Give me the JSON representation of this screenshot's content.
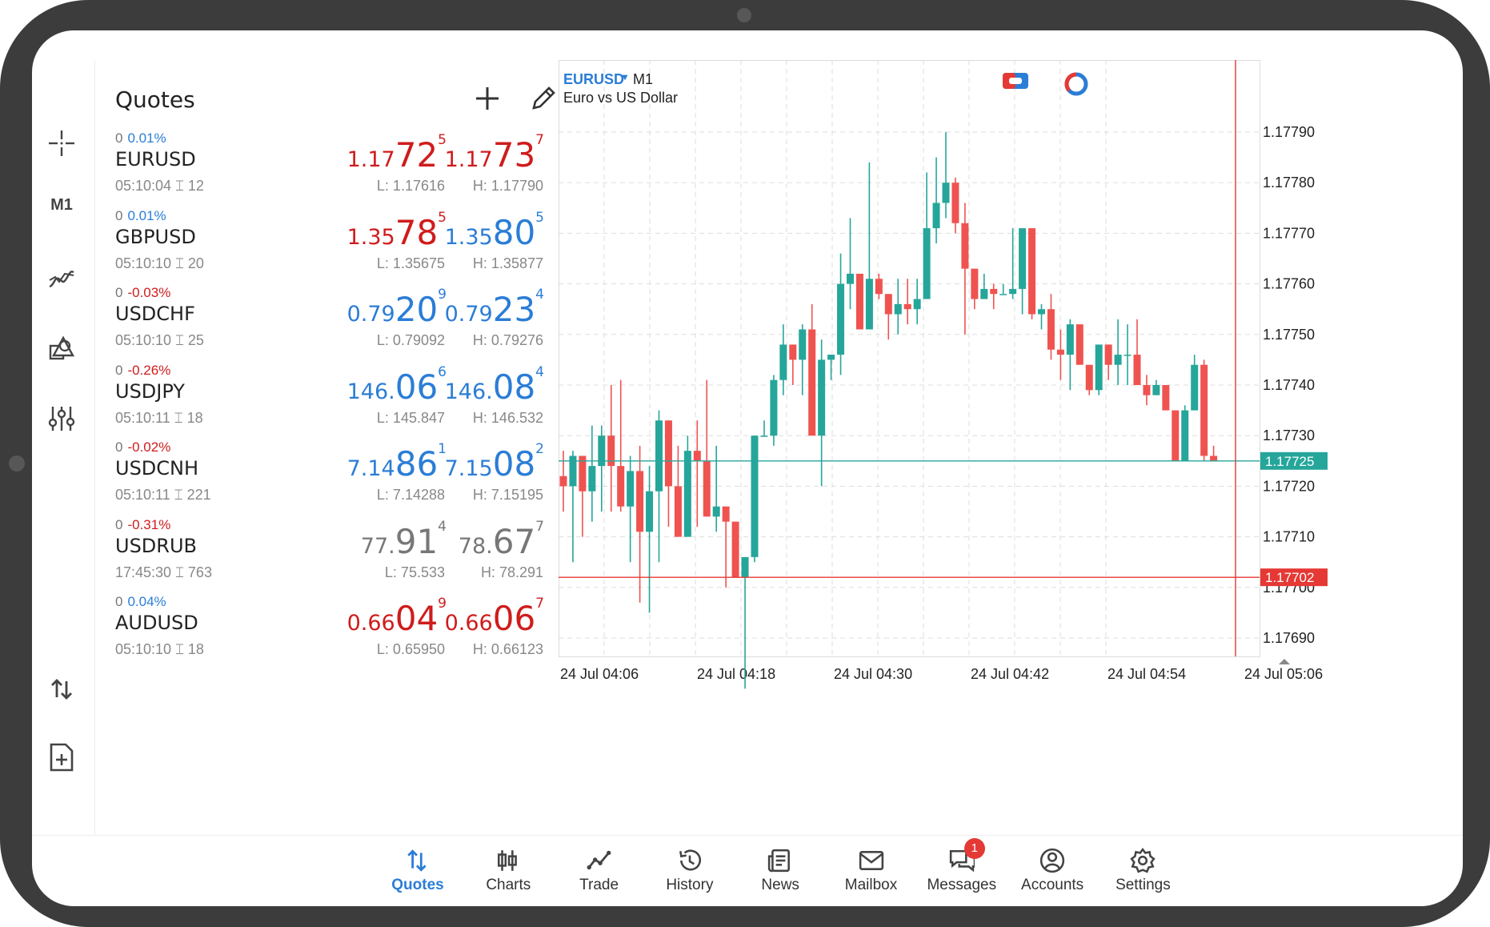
{
  "quotes_panel": {
    "title": "Quotes",
    "rows": [
      {
        "change_pts": "0",
        "change_pct": "0.01%",
        "symbol": "EURUSD",
        "time": "05:10:04",
        "spread": "12",
        "bid_small": "1.17",
        "bid_big": "72",
        "bid_sup": "5",
        "ask_small": "1.17",
        "ask_big": "73",
        "ask_sup": "7",
        "low": "L: 1.17616",
        "high": "H: 1.17790"
      },
      {
        "change_pts": "0",
        "change_pct": "0.01%",
        "symbol": "GBPUSD",
        "time": "05:10:10",
        "spread": "20",
        "bid_small": "1.35",
        "bid_big": "78",
        "bid_sup": "5",
        "ask_small": "1.35",
        "ask_big": "80",
        "ask_sup": "5",
        "low": "L: 1.35675",
        "high": "H: 1.35877"
      },
      {
        "change_pts": "0",
        "change_pct": "-0.03%",
        "symbol": "USDCHF",
        "time": "05:10:10",
        "spread": "25",
        "bid_small": "0.79",
        "bid_big": "20",
        "bid_sup": "9",
        "ask_small": "0.79",
        "ask_big": "23",
        "ask_sup": "4",
        "low": "L: 0.79092",
        "high": "H: 0.79276"
      },
      {
        "change_pts": "0",
        "change_pct": "-0.26%",
        "symbol": "USDJPY",
        "time": "05:10:11",
        "spread": "18",
        "bid_small": "146.",
        "bid_big": "06",
        "bid_sup": "6",
        "ask_small": "146.",
        "ask_big": "08",
        "ask_sup": "4",
        "low": "L: 145.847",
        "high": "H: 146.532"
      },
      {
        "change_pts": "0",
        "change_pct": "-0.02%",
        "symbol": "USDCNH",
        "time": "05:10:11",
        "spread": "221",
        "bid_small": "7.14",
        "bid_big": "86",
        "bid_sup": "1",
        "ask_small": "7.15",
        "ask_big": "08",
        "ask_sup": "2",
        "low": "L: 7.14288",
        "high": "H: 7.15195"
      },
      {
        "change_pts": "0",
        "change_pct": "-0.31%",
        "symbol": "USDRUB",
        "time": "17:45:30",
        "spread": "763",
        "bid_small": "77.",
        "bid_big": "91",
        "bid_sup": "4",
        "ask_small": "78.",
        "ask_big": "67",
        "ask_sup": "7",
        "low": "L: 75.533",
        "high": "H: 78.291"
      },
      {
        "change_pts": "0",
        "change_pct": "0.04%",
        "symbol": "AUDUSD",
        "time": "05:10:10",
        "spread": "18",
        "bid_small": "0.66",
        "bid_big": "04",
        "bid_sup": "9",
        "ask_small": "0.66",
        "ask_big": "06",
        "ask_sup": "7",
        "low": "L: 0.65950",
        "high": "H: 0.66123"
      }
    ]
  },
  "left_toolbar": {
    "timeframe": "M1",
    "icons": [
      "crosshair-icon",
      "indicators-icon",
      "objects-icon",
      "settings-sliders-icon",
      "trade-arrows-icon",
      "new-order-icon"
    ]
  },
  "chart": {
    "symbol": "EURUSD",
    "timeframe": "M1",
    "description": "Euro vs US Dollar",
    "bid_line_label": "1.17725",
    "crosshair_label": "1.17702",
    "colors": {
      "bull": "#26a69a",
      "bear": "#ef5350",
      "bid_line": "#26a69a",
      "crosshair": "#e53935",
      "grid": "#dddddd"
    }
  },
  "chart_data": {
    "type": "candlestick",
    "y_ticks": [
      "1.17790",
      "1.17780",
      "1.17770",
      "1.17760",
      "1.17750",
      "1.17740",
      "1.17730",
      "1.17720",
      "1.17710",
      "1.17700",
      "1.17690"
    ],
    "x_ticks": [
      "24 Jul 04:06",
      "24 Jul 04:18",
      "24 Jul 04:30",
      "24 Jul 04:42",
      "24 Jul 04:54",
      "24 Jul 05:06"
    ],
    "ylim": [
      1.17685,
      1.178
    ],
    "candles": [
      [
        1.17722,
        1.17727,
        1.17715,
        1.1772
      ],
      [
        1.1772,
        1.17727,
        1.17705,
        1.17726
      ],
      [
        1.17726,
        1.17722,
        1.1771,
        1.17719
      ],
      [
        1.17719,
        1.17732,
        1.17713,
        1.17724
      ],
      [
        1.17724,
        1.17732,
        1.17715,
        1.1773
      ],
      [
        1.1773,
        1.1774,
        1.17715,
        1.17724
      ],
      [
        1.17724,
        1.17741,
        1.17715,
        1.17716
      ],
      [
        1.17716,
        1.17726,
        1.17705,
        1.17723
      ],
      [
        1.17723,
        1.17728,
        1.17697,
        1.17711
      ],
      [
        1.17711,
        1.17724,
        1.17695,
        1.17719
      ],
      [
        1.17719,
        1.17735,
        1.17705,
        1.17733
      ],
      [
        1.17733,
        1.17733,
        1.17712,
        1.1772
      ],
      [
        1.1772,
        1.17728,
        1.1771,
        1.1771
      ],
      [
        1.1771,
        1.1773,
        1.17712,
        1.17727
      ],
      [
        1.17727,
        1.17733,
        1.17712,
        1.17725
      ],
      [
        1.17725,
        1.17741,
        1.17714,
        1.17714
      ],
      [
        1.17714,
        1.17728,
        1.17711,
        1.17716
      ],
      [
        1.17716,
        1.17716,
        1.177,
        1.17713
      ],
      [
        1.17713,
        1.17713,
        1.17702,
        1.17702
      ],
      [
        1.17702,
        1.17702,
        1.1768,
        1.17706
      ],
      [
        1.17706,
        1.1773,
        1.17705,
        1.1773
      ],
      [
        1.1773,
        1.17733,
        1.1773,
        1.1773
      ],
      [
        1.1773,
        1.17742,
        1.17728,
        1.17741
      ],
      [
        1.17741,
        1.17752,
        1.17738,
        1.17748
      ],
      [
        1.17748,
        1.17747,
        1.1774,
        1.17745
      ],
      [
        1.17745,
        1.17752,
        1.17738,
        1.17751
      ],
      [
        1.17751,
        1.17756,
        1.1773,
        1.1773
      ],
      [
        1.1773,
        1.17749,
        1.1772,
        1.17745
      ],
      [
        1.17745,
        1.17742,
        1.17741,
        1.17746
      ],
      [
        1.17746,
        1.17766,
        1.17742,
        1.1776
      ],
      [
        1.1776,
        1.17773,
        1.17755,
        1.17762
      ],
      [
        1.17762,
        1.17762,
        1.17753,
        1.17751
      ],
      [
        1.17751,
        1.17784,
        1.17751,
        1.17761
      ],
      [
        1.17761,
        1.17762,
        1.17757,
        1.17758
      ],
      [
        1.17758,
        1.17758,
        1.17749,
        1.17754
      ],
      [
        1.17754,
        1.17761,
        1.1775,
        1.17756
      ],
      [
        1.17756,
        1.17761,
        1.17752,
        1.17755
      ],
      [
        1.17755,
        1.17761,
        1.17752,
        1.17757
      ],
      [
        1.17757,
        1.17782,
        1.17757,
        1.17771
      ],
      [
        1.17771,
        1.17785,
        1.17768,
        1.17776
      ],
      [
        1.17776,
        1.1779,
        1.17773,
        1.1778
      ],
      [
        1.1778,
        1.17781,
        1.1777,
        1.17772
      ],
      [
        1.17772,
        1.17776,
        1.1775,
        1.17763
      ],
      [
        1.17763,
        1.17763,
        1.17755,
        1.17757
      ],
      [
        1.17757,
        1.17762,
        1.17757,
        1.17759
      ],
      [
        1.17759,
        1.1776,
        1.17755,
        1.17758
      ],
      [
        1.17758,
        1.1776,
        1.17758,
        1.17758
      ],
      [
        1.17758,
        1.17771,
        1.17757,
        1.17759
      ],
      [
        1.17759,
        1.17771,
        1.17754,
        1.17771
      ],
      [
        1.17771,
        1.17771,
        1.17753,
        1.17754
      ],
      [
        1.17754,
        1.17756,
        1.17751,
        1.17755
      ],
      [
        1.17755,
        1.17758,
        1.17745,
        1.17747
      ],
      [
        1.17747,
        1.17751,
        1.17741,
        1.17746
      ],
      [
        1.17746,
        1.17753,
        1.17739,
        1.17752
      ],
      [
        1.17752,
        1.17752,
        1.17744,
        1.17744
      ],
      [
        1.17744,
        1.17744,
        1.17738,
        1.17739
      ],
      [
        1.17739,
        1.17748,
        1.17738,
        1.17748
      ],
      [
        1.17748,
        1.17748,
        1.17741,
        1.17744
      ],
      [
        1.17744,
        1.17753,
        1.1774,
        1.17746
      ],
      [
        1.17746,
        1.17752,
        1.1774,
        1.17746
      ],
      [
        1.17746,
        1.17753,
        1.17743,
        1.1774
      ],
      [
        1.1774,
        1.17742,
        1.17736,
        1.17738
      ],
      [
        1.17738,
        1.17741,
        1.1774,
        1.1774
      ],
      [
        1.1774,
        1.1774,
        1.17735,
        1.17735
      ],
      [
        1.17735,
        1.17735,
        1.17725,
        1.17725
      ],
      [
        1.17725,
        1.17736,
        1.17725,
        1.17735
      ],
      [
        1.17735,
        1.17746,
        1.17735,
        1.17744
      ],
      [
        1.17744,
        1.17745,
        1.17725,
        1.17726
      ],
      [
        1.17726,
        1.17728,
        1.17725,
        1.17725
      ]
    ]
  },
  "bottom_nav": {
    "items": [
      {
        "label": "Quotes",
        "icon": "quotes-icon"
      },
      {
        "label": "Charts",
        "icon": "charts-icon"
      },
      {
        "label": "Trade",
        "icon": "trade-icon"
      },
      {
        "label": "History",
        "icon": "history-icon"
      },
      {
        "label": "News",
        "icon": "news-icon"
      },
      {
        "label": "Mailbox",
        "icon": "mailbox-icon"
      },
      {
        "label": "Messages",
        "icon": "messages-icon",
        "badge": "1"
      },
      {
        "label": "Accounts",
        "icon": "accounts-icon"
      },
      {
        "label": "Settings",
        "icon": "settings-icon"
      }
    ]
  }
}
